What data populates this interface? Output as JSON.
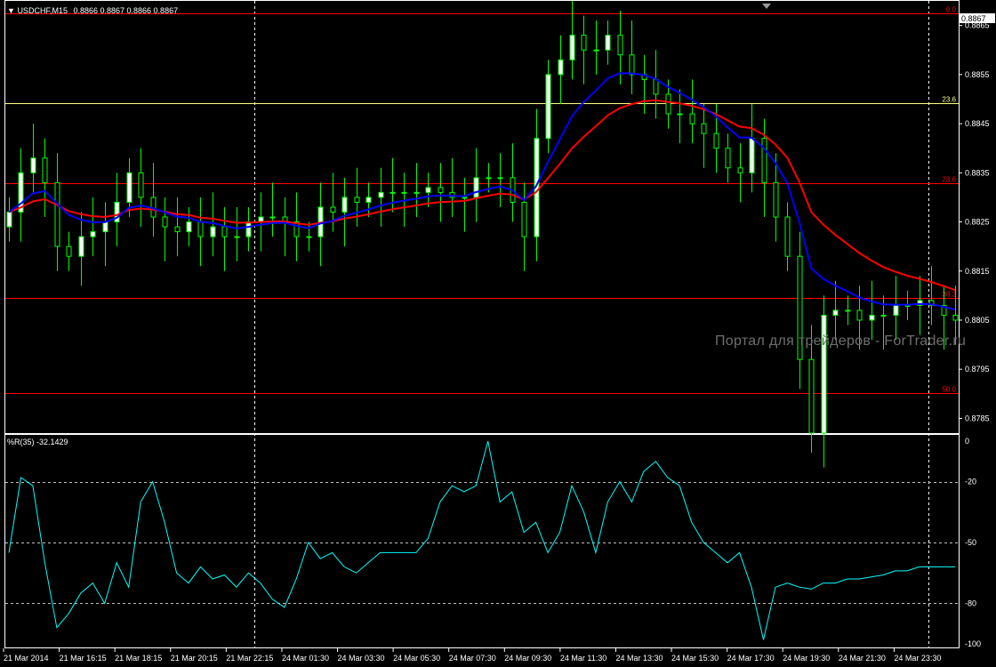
{
  "main_chart": {
    "title": "USDCHF,M15",
    "quote": "0.8866 0.8867 0.8866 0.8867",
    "current_price_label": "0.8867",
    "watermark": "Портал для трейдеров - ForTrader.ru",
    "price_ticks": [
      "0.8865",
      "0.8855",
      "0.8845",
      "0.8835",
      "0.8825",
      "0.8815",
      "0.8805",
      "0.8795",
      "0.8785"
    ],
    "fib_levels": [
      {
        "label": "0.0",
        "price": 0.88675,
        "color": "#ff0000"
      },
      {
        "label": "23.6",
        "price": 0.88492,
        "color": "#ffff80"
      },
      {
        "label": "23.6",
        "price": 0.88328,
        "color": "#ff0000"
      },
      {
        "label": "38.2",
        "price": 0.88095,
        "color": "#ff0000"
      },
      {
        "label": "50.0",
        "price": 0.87902,
        "color": "#ff0000"
      }
    ],
    "ema_fast_color": "#0000ff",
    "ema_slow_color": "#ff0000",
    "candle_up_color": "#ffffff",
    "candle_down_color": "#000000",
    "wick_color": "#00ff00"
  },
  "indicator": {
    "title": "%R(35) -32.1429",
    "ticks": [
      "0",
      "-20",
      "-50",
      "-80",
      "-100"
    ],
    "line_color": "#00ffff"
  },
  "time_axis": {
    "labels": [
      "21 Mar 2014",
      "21 Mar 16:15",
      "21 Mar 18:15",
      "21 Mar 20:15",
      "21 Mar 22:15",
      "24 Mar 01:30",
      "24 Mar 03:30",
      "24 Mar 05:30",
      "24 Mar 07:30",
      "24 Mar 09:30",
      "24 Mar 11:30",
      "24 Mar 13:30",
      "24 Mar 15:30",
      "24 Mar 17:30",
      "24 Mar 19:30",
      "24 Mar 21:30",
      "24 Mar 23:30"
    ]
  },
  "chart_data": {
    "type": "line",
    "title": "USDCHF,M15",
    "y_range": [
      0.8782,
      0.887
    ],
    "wpr_range": [
      -100,
      0
    ],
    "series": [
      {
        "name": "close",
        "values": [
          0.8827,
          0.8835,
          0.8838,
          0.8833,
          0.882,
          0.8818,
          0.8822,
          0.8823,
          0.8825,
          0.8829,
          0.8835,
          0.883,
          0.8826,
          0.8824,
          0.8823,
          0.8825,
          0.8822,
          0.8824,
          0.8822,
          0.8822,
          0.8825,
          0.8826,
          0.8826,
          0.8825,
          0.8822,
          0.8822,
          0.8828,
          0.8827,
          0.883,
          0.8829,
          0.883,
          0.8831,
          0.8831,
          0.8831,
          0.8831,
          0.8832,
          0.8831,
          0.883,
          0.883,
          0.8834,
          0.8834,
          0.8834,
          0.8829,
          0.8822,
          0.8842,
          0.8855,
          0.8858,
          0.8863,
          0.886,
          0.886,
          0.8863,
          0.8859,
          0.8855,
          0.8854,
          0.8851,
          0.8847,
          0.8847,
          0.8845,
          0.8843,
          0.884,
          0.8836,
          0.8835,
          0.8842,
          0.8833,
          0.8826,
          0.8818,
          0.8797,
          0.8782,
          0.8806,
          0.8807,
          0.8807,
          0.8805,
          0.8806,
          0.8806,
          0.8808,
          0.8808,
          0.8809,
          0.8808,
          0.8806,
          0.8805
        ]
      },
      {
        "name": "%R(35)",
        "values": [
          -55,
          -18,
          -22,
          -60,
          -92,
          -85,
          -75,
          -70,
          -80,
          -60,
          -72,
          -30,
          -20,
          -40,
          -65,
          -70,
          -62,
          -68,
          -66,
          -72,
          -65,
          -70,
          -78,
          -82,
          -68,
          -50,
          -58,
          -55,
          -62,
          -65,
          -60,
          -55,
          -55,
          -55,
          -55,
          -48,
          -30,
          -22,
          -25,
          -22,
          0,
          -30,
          -25,
          -45,
          -40,
          -55,
          -45,
          -22,
          -35,
          -55,
          -30,
          -20,
          -30,
          -15,
          -10,
          -18,
          -22,
          -40,
          -50,
          -55,
          -60,
          -55,
          -72,
          -98,
          -72,
          -70,
          -72,
          -73,
          -70,
          -70,
          -68,
          -68,
          -67,
          -66,
          -64,
          -64,
          -62,
          -62,
          -62,
          -62
        ]
      }
    ]
  }
}
